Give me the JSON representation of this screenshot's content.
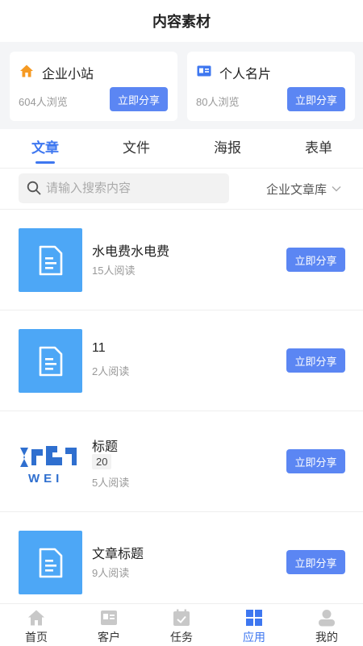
{
  "header": {
    "title": "内容素材"
  },
  "stats": [
    {
      "title": "企业小站",
      "views": "604人浏览",
      "share_label": "立即分享",
      "icon": "home-icon",
      "icon_color": "#f59a23"
    },
    {
      "title": "个人名片",
      "views": "80人浏览",
      "share_label": "立即分享",
      "icon": "id-card-icon",
      "icon_color": "#3e77f0"
    }
  ],
  "tabs": [
    {
      "label": "文章",
      "active": true
    },
    {
      "label": "文件",
      "active": false
    },
    {
      "label": "海报",
      "active": false
    },
    {
      "label": "表单",
      "active": false
    }
  ],
  "search": {
    "placeholder": "请输入搜索内容",
    "value": ""
  },
  "library_select": {
    "value": "企业文章库"
  },
  "articles": [
    {
      "title": "水电费水电费",
      "reads": "15人阅读",
      "share_label": "立即分享",
      "thumb": "document-icon"
    },
    {
      "title": "11",
      "reads": "2人阅读",
      "share_label": "立即分享",
      "thumb": "document-icon"
    },
    {
      "title": "标题",
      "tag": "20",
      "reads": "5人阅读",
      "share_label": "立即分享",
      "thumb": "image-thumbnail",
      "thumb_text": "WEI"
    },
    {
      "title": "文章标题",
      "reads": "9人阅读",
      "share_label": "立即分享",
      "thumb": "document-icon"
    }
  ],
  "bottom_nav": [
    {
      "label": "首页",
      "icon": "home-icon",
      "active": false
    },
    {
      "label": "客户",
      "icon": "contact-card-icon",
      "active": false
    },
    {
      "label": "任务",
      "icon": "calendar-check-icon",
      "active": false
    },
    {
      "label": "应用",
      "icon": "apps-grid-icon",
      "active": true
    },
    {
      "label": "我的",
      "icon": "user-icon",
      "active": false
    }
  ],
  "colors": {
    "accent": "#3e77f0",
    "button": "#5b86f3",
    "doc_thumb": "#4da7f6",
    "inactive_icon": "#c8c8c8"
  }
}
